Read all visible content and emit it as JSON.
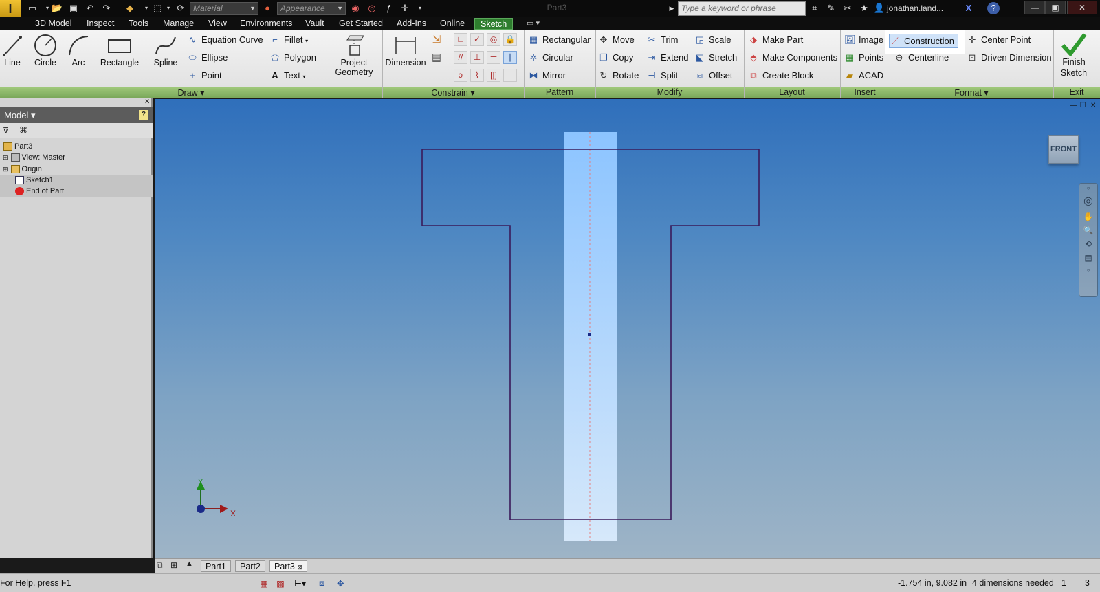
{
  "title_bar": {
    "doc_title": "Part3",
    "material_placeholder": "Material",
    "appearance_placeholder": "Appearance",
    "search_placeholder": "Type a keyword or phrase",
    "user": "jonathan.land...",
    "icons": [
      "new-icon",
      "open-icon",
      "save-icon",
      "undo-icon",
      "redo-icon",
      "project-icon",
      "select-icon",
      "update-icon",
      "color-icon",
      "adjust-icon",
      "fx-icon",
      "measure-icon",
      "binoculars-icon",
      "wrench-icon",
      "star-icon",
      "user-icon",
      "exchange-icon",
      "help-icon"
    ]
  },
  "menu": {
    "tabs": [
      "3D Model",
      "Inspect",
      "Tools",
      "Manage",
      "View",
      "Environments",
      "Vault",
      "Get Started",
      "Add-Ins",
      "Online",
      "Sketch"
    ],
    "active": "Sketch"
  },
  "ribbon": {
    "draw": {
      "line": "Line",
      "circle": "Circle",
      "arc": "Arc",
      "rectangle": "Rectangle",
      "spline": "Spline",
      "equation_curve": "Equation Curve",
      "ellipse": "Ellipse",
      "point": "Point",
      "fillet": "Fillet",
      "polygon": "Polygon",
      "text": "Text",
      "project_geometry": "Project Geometry"
    },
    "constrain": {
      "dimension": "Dimension"
    },
    "pattern": {
      "rectangular": "Rectangular",
      "circular": "Circular",
      "mirror": "Mirror"
    },
    "modify": {
      "move": "Move",
      "copy": "Copy",
      "rotate": "Rotate",
      "trim": "Trim",
      "extend": "Extend",
      "split": "Split",
      "scale": "Scale",
      "stretch": "Stretch",
      "offset": "Offset"
    },
    "layout": {
      "make_part": "Make Part",
      "make_components": "Make Components",
      "create_block": "Create Block"
    },
    "insert": {
      "image": "Image",
      "points": "Points",
      "acad": "ACAD"
    },
    "format": {
      "construction": "Construction",
      "centerline": "Centerline",
      "center_point": "Center Point",
      "driven_dimension": "Driven Dimension"
    },
    "exit": {
      "finish_sketch": "Finish Sketch"
    },
    "panels": {
      "draw": "Draw",
      "constrain": "Constrain",
      "pattern": "Pattern",
      "modify": "Modify",
      "layout": "Layout",
      "insert": "Insert",
      "format": "Format",
      "exit": "Exit"
    }
  },
  "browser": {
    "header": "Model",
    "tree": [
      {
        "label": "Part3"
      },
      {
        "label": "View: Master"
      },
      {
        "label": "Origin"
      },
      {
        "label": "Sketch1"
      },
      {
        "label": "End of Part"
      }
    ]
  },
  "viewport": {
    "viewcube_label": "FRONT",
    "axis_x": "X",
    "axis_y": "Y"
  },
  "doc_tabs": [
    "Part1",
    "Part2",
    "Part3"
  ],
  "status": {
    "help": "For Help, press F1",
    "coords": "-1.754 in, 9.082 in",
    "dims": "4 dimensions needed",
    "count1": "1",
    "count2": "3"
  },
  "colors": {
    "ribbon_panel_green": "#8bb86a",
    "active_tab_green": "#2e7d2e",
    "sketch_line": "#3a1a5a",
    "highlight_band": "#bfe0ff",
    "construction_blue": "#cfe2f8"
  }
}
